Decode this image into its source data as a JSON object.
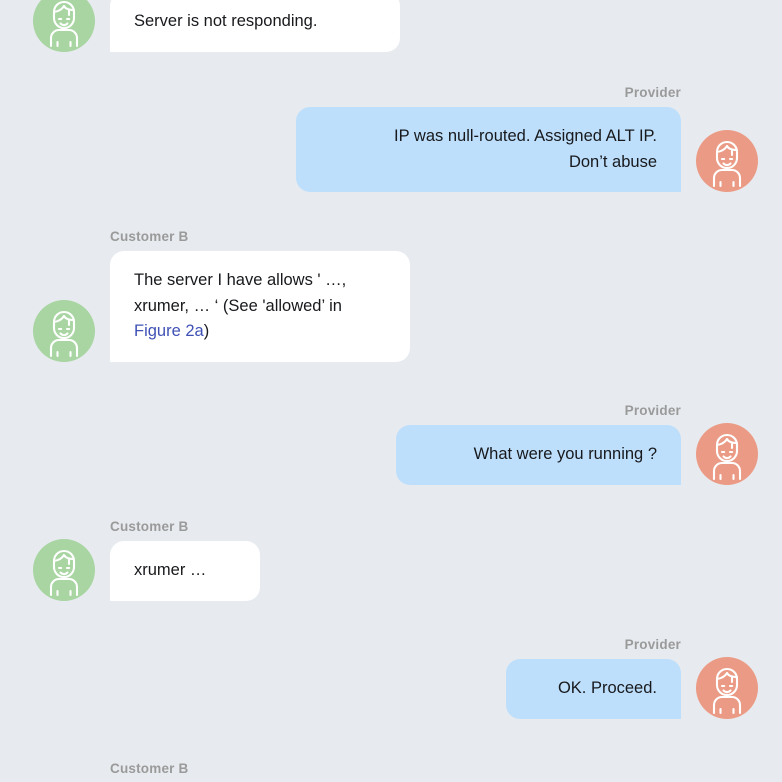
{
  "theme": {
    "background": "#e7ebef",
    "customer_bubble": "#ffffff",
    "provider_bubble": "#bedffc",
    "customer_avatar": "#a8d5a2",
    "provider_avatar": "#eb9b85",
    "speaker_label": "#9a9a9a",
    "link": "#3f51b5",
    "text": "#17191c"
  },
  "labels": {
    "customer_b": "Customer B",
    "provider": "Provider"
  },
  "messages": [
    {
      "id": "m1",
      "side": "left",
      "speaker": "",
      "avatar": "customer-avatar-icon",
      "text": "Server is not responding."
    },
    {
      "id": "m2",
      "side": "right",
      "speaker": "Provider",
      "avatar": "provider-avatar-icon",
      "line1": "IP was null-routed. Assigned ALT IP.",
      "line2": "Don’t abuse"
    },
    {
      "id": "m3",
      "side": "left",
      "speaker": "Customer B",
      "avatar": "customer-avatar-icon",
      "text_before": "The server I have allows ' …, xrumer, … ‘ (See 'allowed’ in ",
      "link_text": "Figure 2a",
      "text_after": ")"
    },
    {
      "id": "m4",
      "side": "right",
      "speaker": "Provider",
      "avatar": "provider-avatar-icon",
      "text": "What were you running ?"
    },
    {
      "id": "m5",
      "side": "left",
      "speaker": "Customer B",
      "avatar": "customer-avatar-icon",
      "text": "xrumer …"
    },
    {
      "id": "m6",
      "side": "right",
      "speaker": "Provider",
      "avatar": "provider-avatar-icon",
      "text": "OK. Proceed."
    }
  ],
  "trailing_label": "Customer B"
}
